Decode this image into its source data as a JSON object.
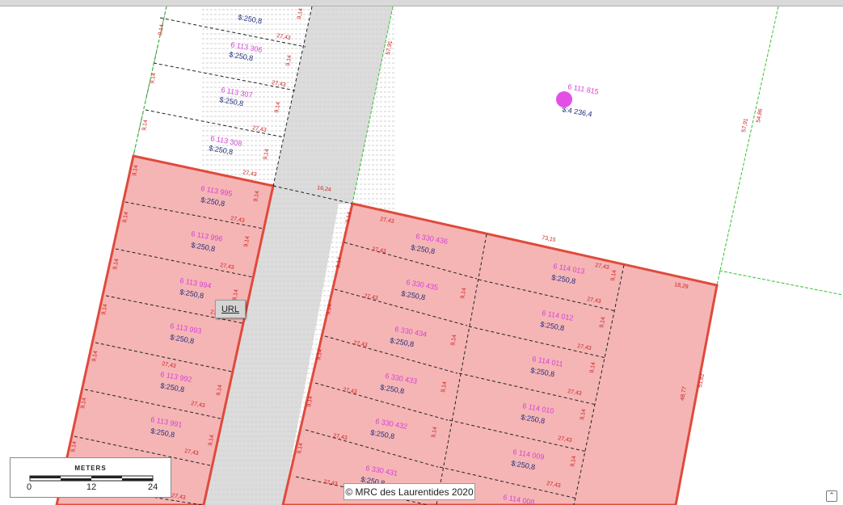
{
  "map": {
    "url_label": "URL",
    "attribution": "© MRC des Laurentides 2020",
    "scalebar": {
      "title": "METERS",
      "ticks": [
        "0",
        "12",
        "24"
      ]
    },
    "collapse_icon": "double-chevron-up-icon",
    "colors": {
      "parcel_fill": "#f5b5b5",
      "parcel_border": "#e04a3c",
      "road_fill": "#dcdcdc",
      "green_line": "#33c233",
      "id_text": "#d63fd6",
      "area_text": "#1d2b7a",
      "dim_text": "#d22020",
      "point": "#e34fe6"
    }
  },
  "parcels": {
    "north": [
      {
        "id": "",
        "area": "$:250,8"
      },
      {
        "id": "6 113 306",
        "area": "$:250,8"
      },
      {
        "id": "6 113 307",
        "area": "$:250,8"
      },
      {
        "id": "6 113 308",
        "area": "$:250,8"
      }
    ],
    "west": [
      {
        "id": "6 113 995",
        "area": "$:250,8"
      },
      {
        "id": "6 113 996",
        "area": "$:250,8"
      },
      {
        "id": "6 113 994",
        "area": "$:250,8"
      },
      {
        "id": "6 113 993",
        "area": "$:250,8"
      },
      {
        "id": "6 113 992",
        "area": "$:250,8"
      },
      {
        "id": "6 113 991",
        "area": "$:250,8"
      }
    ],
    "east_a": [
      {
        "id": "6 330 436",
        "area": "$:250,8"
      },
      {
        "id": "6 330 435",
        "area": "$:250,8"
      },
      {
        "id": "6 330 434",
        "area": "$:250,8"
      },
      {
        "id": "6 330 433",
        "area": "$:250,8"
      },
      {
        "id": "6 330 432",
        "area": "$:250,8"
      },
      {
        "id": "6 330 431",
        "area": "$:250,8"
      }
    ],
    "east_b": [
      {
        "id": "6 114 013",
        "area": "$:250,8"
      },
      {
        "id": "6 114 012",
        "area": "$:250,8"
      },
      {
        "id": "6 114 011",
        "area": "$:250,8"
      },
      {
        "id": "6 114 010",
        "area": "$:250,8"
      },
      {
        "id": "6 114 009",
        "area": "$:250,8"
      },
      {
        "id": "6 114 008",
        "area": ""
      }
    ],
    "big": {
      "id": "6 111 815",
      "area": "$:4 236,4"
    }
  },
  "dimensions": {
    "lot_depth": "27,43",
    "lot_width": "9,14",
    "road_width": "16,24",
    "road_side": "57,91",
    "block_top": "73,15",
    "corner": "18,29",
    "east_side_a": "48,77",
    "east_side_b": "51,82",
    "big_east_a": "57,91",
    "big_east_b": "54,86"
  }
}
